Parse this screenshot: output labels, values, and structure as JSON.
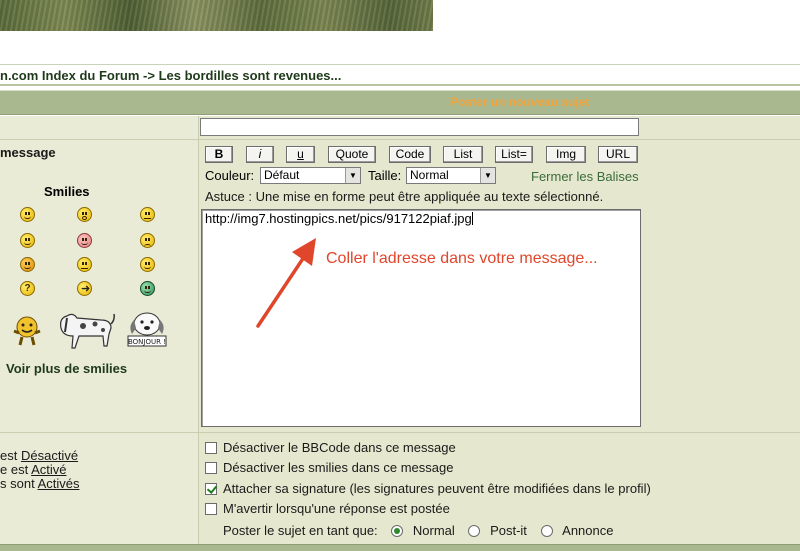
{
  "breadcrumb": {
    "site": "n.com Index du Forum",
    "separator": "->",
    "topic": "Les bordilles sont revenues..."
  },
  "header": {
    "title": "Poster un nouveau sujet"
  },
  "subject": {
    "value": ""
  },
  "left": {
    "message_label": "message",
    "smilies_title": "Smilies",
    "voir_plus": "Voir plus de smilies",
    "status": [
      {
        "prefix": "est ",
        "value": "Désactivé"
      },
      {
        "prefix": "e est ",
        "value": "Activé"
      },
      {
        "prefix": "s sont ",
        "value": "Activés"
      }
    ]
  },
  "toolbar": {
    "buttons": [
      "B",
      "i",
      "u",
      "Quote",
      "Code",
      "List",
      "List=",
      "Img",
      "URL"
    ]
  },
  "format": {
    "color_label": "Couleur:",
    "color_value": "Défaut",
    "size_label": "Taille:",
    "size_value": "Normal",
    "close_tags": "Fermer les Balises"
  },
  "tip": "Astuce : Une mise en forme peut être appliquée au texte sélectionné.",
  "message": {
    "value": "http://img7.hostingpics.net/pics/917122piaf.jpg"
  },
  "annotation": "Coller l'adresse dans votre message...",
  "options": {
    "disable_bbcode": "Désactiver le BBCode dans ce message",
    "disable_smilies": "Désactiver les smilies dans ce message",
    "attach_signature": "Attacher sa signature (les signatures peuvent être modifiées dans le profil)",
    "notify": "M'avertir lorsqu'une réponse est postée",
    "post_as_label": "Poster le sujet en tant que:",
    "post_types": [
      "Normal",
      "Post-it",
      "Annonce"
    ]
  },
  "colors": {
    "header_bg": "#a9b88e",
    "header_title": "#f2a33a",
    "panel_bg": "#e5e8cf",
    "annotation": "#e0462b"
  }
}
